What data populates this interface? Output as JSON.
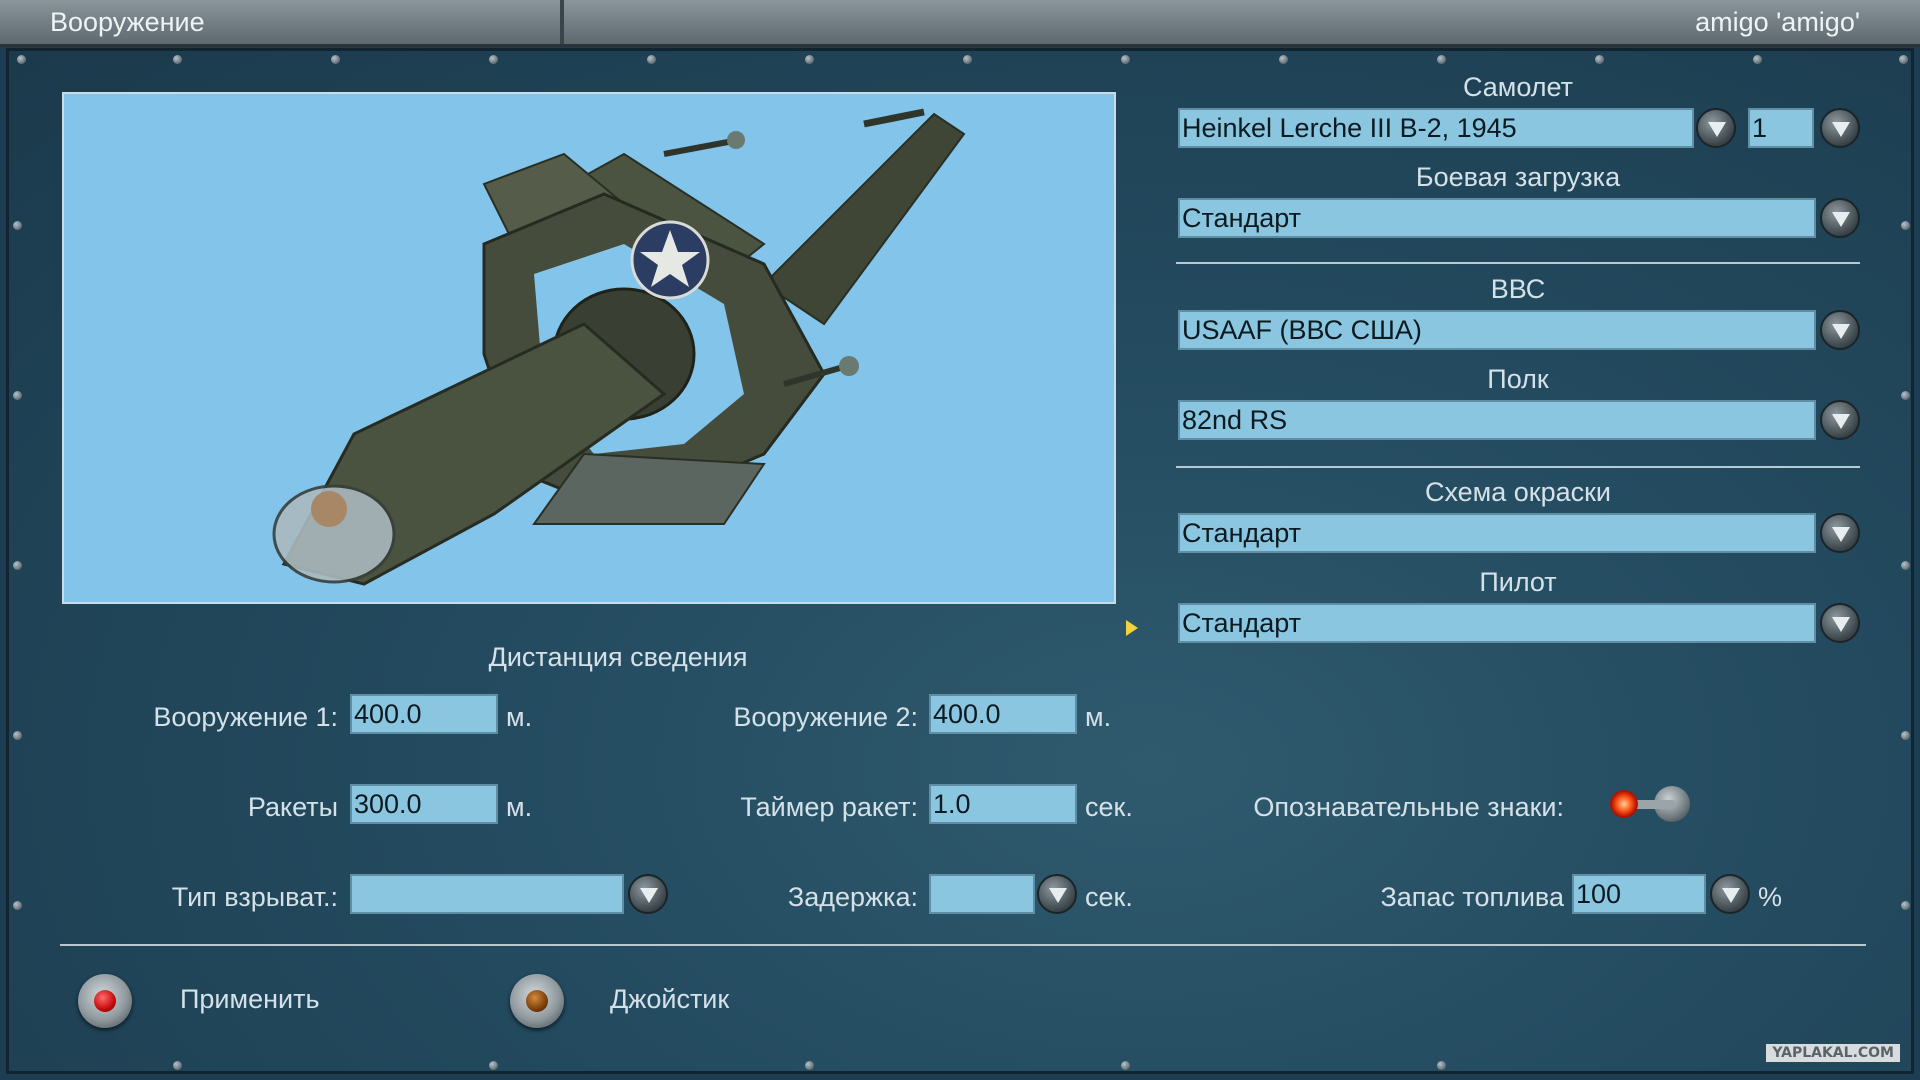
{
  "window": {
    "title": "Вооружение",
    "user": "amigo 'amigo'"
  },
  "aircraft": {
    "label": "Самолет",
    "value": "Heinkel Lerche III B-2, 1945",
    "number": "1"
  },
  "loadout": {
    "label": "Боевая загрузка",
    "value": "Стандарт"
  },
  "air_force": {
    "label": "ВВС",
    "value": "USAAF (ВВС США)"
  },
  "regiment": {
    "label": "Полк",
    "value": "82nd RS"
  },
  "paint": {
    "label": "Схема окраски",
    "value": "Стандарт"
  },
  "pilot": {
    "label": "Пилот",
    "value": "Стандарт"
  },
  "convergence": {
    "heading": "Дистанция сведения",
    "weapon1": {
      "label": "Вооружение 1:",
      "value": "400.0",
      "unit": "м."
    },
    "weapon2": {
      "label": "Вооружение 2:",
      "value": "400.0",
      "unit": "м."
    },
    "rockets": {
      "label": "Ракеты",
      "value": "300.0",
      "unit": "м."
    },
    "rocket_timer": {
      "label": "Таймер ракет:",
      "value": "1.0",
      "unit": "сек."
    },
    "fuze_type": {
      "label": "Тип взрыват.:",
      "value": ""
    },
    "delay": {
      "label": "Задержка:",
      "value": "",
      "unit": "сек."
    }
  },
  "markings": {
    "label": "Опознавательные знаки:",
    "enabled": true
  },
  "fuel": {
    "label": "Запас топлива",
    "value": "100",
    "unit": "%"
  },
  "buttons": {
    "apply": "Применить",
    "joystick": "Джойстик"
  },
  "watermark": "YAPLAKAL.COM",
  "colors": {
    "viewport_sky": "#82c4ea",
    "field_bg": "#8ac6df",
    "panel": "#244b60"
  },
  "icons": [
    "dropdown-arrow-icon",
    "red-led-icon",
    "brown-led-icon",
    "toggle-switch-icon",
    "cursor-icon",
    "usaaf-star-insignia"
  ]
}
